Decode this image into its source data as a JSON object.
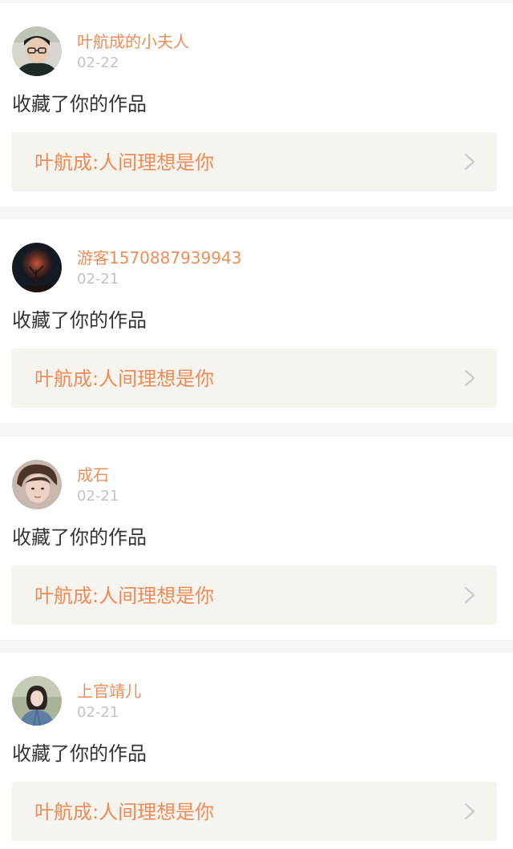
{
  "feed": {
    "items": [
      {
        "username": "叶航成的小夫人",
        "date": "02-22",
        "action": "收藏了你的作品",
        "work_title": "叶航成:人间理想是你",
        "avatar_icon": "avatar-young-man-glasses"
      },
      {
        "username": "游客1570887939943",
        "date": "02-21",
        "action": "收藏了你的作品",
        "work_title": "叶航成:人间理想是你",
        "avatar_icon": "avatar-glowing-tree"
      },
      {
        "username": "成石",
        "date": "02-21",
        "action": "收藏了你的作品",
        "work_title": "叶航成:人间理想是你",
        "avatar_icon": "avatar-man-portrait"
      },
      {
        "username": "上官靖儿",
        "date": "02-21",
        "action": "收藏了你的作品",
        "work_title": "叶航成:人间理想是你",
        "avatar_icon": "avatar-woman-denim-jacket"
      }
    ]
  },
  "colors": {
    "username": "#ec8f5a",
    "work_title": "#ef8b57",
    "date": "#c3c3c3",
    "action": "#333333",
    "link_background": "#f5f4ee",
    "page_background": "#f7f5f5"
  }
}
